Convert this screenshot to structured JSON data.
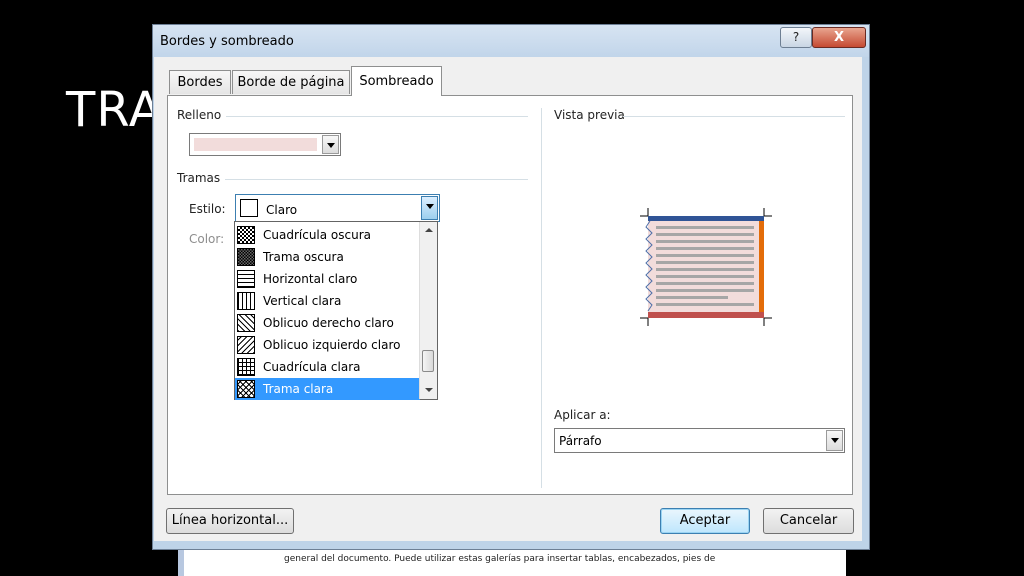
{
  "slide": {
    "title": "TRA",
    "doc_text": "general del documento. Puede utilizar estas galerías para insertar tablas, encabezados, pies de"
  },
  "dialog": {
    "title": "Bordes y sombreado",
    "help_symbol": "?",
    "close_symbol": "X",
    "tabs": [
      {
        "label": "Bordes",
        "active": false
      },
      {
        "label": "Borde de página",
        "active": false
      },
      {
        "label": "Sombreado",
        "active": true
      }
    ],
    "fill": {
      "group_label": "Relleno",
      "color": "#f2dcdb"
    },
    "patterns": {
      "group_label": "Tramas",
      "style_label": "Estilo:",
      "style_value": "Claro",
      "color_label": "Color:",
      "dropdown_items": [
        {
          "label": "Cuadrícula oscura",
          "pattern": "dark-checker",
          "selected": false
        },
        {
          "label": "Trama oscura",
          "pattern": "dark-dots",
          "selected": false
        },
        {
          "label": "Horizontal claro",
          "pattern": "light-horizontal",
          "selected": false
        },
        {
          "label": "Vertical clara",
          "pattern": "light-vertical",
          "selected": false
        },
        {
          "label": "Oblicuo derecho claro",
          "pattern": "light-diag-right",
          "selected": false
        },
        {
          "label": "Oblicuo izquierdo claro",
          "pattern": "light-diag-left",
          "selected": false
        },
        {
          "label": "Cuadrícula clara",
          "pattern": "light-grid",
          "selected": false
        },
        {
          "label": "Trama clara",
          "pattern": "light-trellis",
          "selected": true
        }
      ]
    },
    "preview": {
      "group_label": "Vista previa",
      "top_border_color": "#2f5496",
      "bottom_border_color": "#c0504d",
      "right_border_color": "#e36c09",
      "fill_color": "#f2dcdb"
    },
    "apply": {
      "label": "Aplicar a:",
      "value": "Párrafo"
    },
    "buttons": {
      "horizontal_line": "Línea horizontal...",
      "ok": "Aceptar",
      "cancel": "Cancelar"
    },
    "selection_color": "#3399ff"
  }
}
